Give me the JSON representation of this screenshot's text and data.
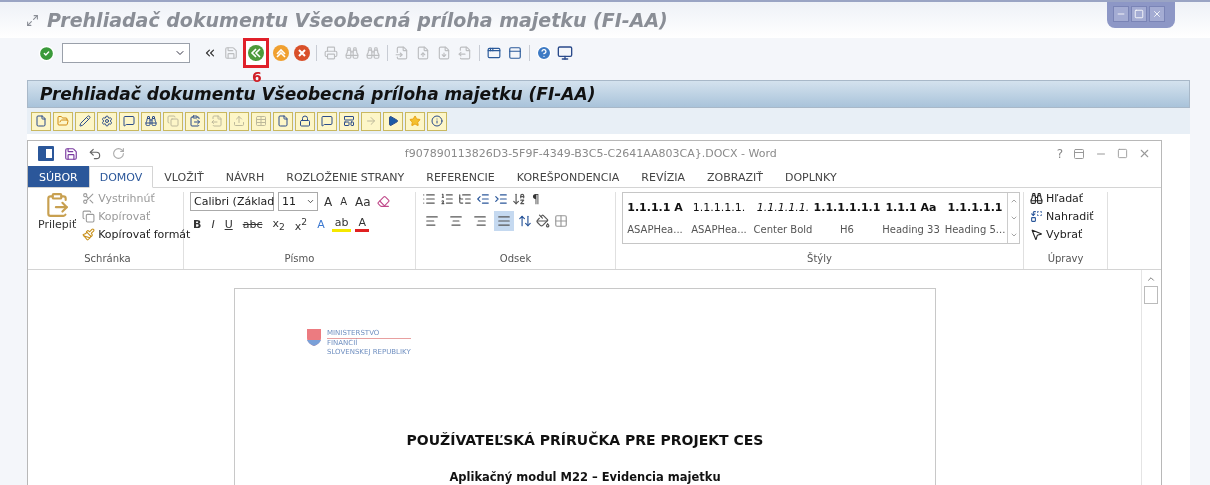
{
  "window": {
    "title": "Prehliadač dokumentu Všeobecná príloha majetku  (FI-AA)",
    "controls": [
      {
        "kind": "minimize"
      },
      {
        "kind": "maximize"
      },
      {
        "kind": "close"
      }
    ]
  },
  "toolbar": {
    "groups": [
      {
        "separator_before": false,
        "buttons": [
          {
            "kind": "enter",
            "disabled": false,
            "highlighted": false
          }
        ]
      },
      {
        "separator_before": false,
        "buttons": [
          {
            "kind": "collapse",
            "disabled": false,
            "highlighted": false
          },
          {
            "kind": "save",
            "disabled": true,
            "highlighted": false
          },
          {
            "kind": "back",
            "disabled": false,
            "highlighted": true
          },
          {
            "kind": "exit",
            "disabled": false,
            "highlighted": false
          },
          {
            "kind": "cancel",
            "disabled": false,
            "highlighted": false
          }
        ]
      },
      {
        "separator_before": true,
        "buttons": [
          {
            "kind": "print",
            "disabled": true,
            "highlighted": false
          },
          {
            "kind": "find",
            "disabled": true,
            "highlighted": false
          },
          {
            "kind": "findnext",
            "disabled": true,
            "highlighted": false
          }
        ]
      },
      {
        "separator_before": true,
        "buttons": [
          {
            "kind": "first",
            "disabled": true,
            "highlighted": false
          },
          {
            "kind": "previous",
            "disabled": true,
            "highlighted": false
          },
          {
            "kind": "next",
            "disabled": true,
            "highlighted": false
          },
          {
            "kind": "last",
            "disabled": true,
            "highlighted": false
          }
        ]
      },
      {
        "separator_before": true,
        "buttons": [
          {
            "kind": "session",
            "disabled": false,
            "highlighted": false
          },
          {
            "kind": "shortcut",
            "disabled": false,
            "highlighted": false
          }
        ]
      },
      {
        "separator_before": true,
        "buttons": [
          {
            "kind": "help",
            "disabled": false,
            "highlighted": false
          },
          {
            "kind": "layout",
            "disabled": false,
            "highlighted": false
          }
        ]
      }
    ],
    "annotation": "6"
  },
  "screen": {
    "title": "Prehliadač dokumentu Všeobecná príloha majetku  (FI-AA)",
    "app_toolbar": [
      {
        "kind": "new",
        "disabled": false
      },
      {
        "kind": "open",
        "disabled": false
      },
      {
        "kind": "edit",
        "disabled": false
      },
      {
        "kind": "settings",
        "disabled": false
      },
      {
        "kind": "comment",
        "disabled": false
      },
      {
        "kind": "find",
        "disabled": false
      },
      {
        "kind": "copy",
        "disabled": true
      },
      {
        "kind": "paste",
        "disabled": false
      },
      {
        "kind": "export",
        "disabled": true
      },
      {
        "kind": "upload",
        "disabled": true
      },
      {
        "kind": "table",
        "disabled": true
      },
      {
        "kind": "new",
        "disabled": false
      },
      {
        "kind": "lock",
        "disabled": false
      },
      {
        "kind": "comment",
        "disabled": false
      },
      {
        "kind": "template",
        "disabled": false
      },
      {
        "kind": "forward",
        "disabled": true
      },
      {
        "kind": "play",
        "disabled": false
      },
      {
        "kind": "star",
        "disabled": false
      },
      {
        "kind": "info",
        "disabled": false
      }
    ]
  },
  "word": {
    "title": "f907890113826D3-5F9F-4349-B3C5-C2641AA803CA}.DOCX - Word",
    "help": "?",
    "tabs": [
      {
        "label": "SÚBOR",
        "kind": "file",
        "selected": false
      },
      {
        "label": "DOMOV",
        "kind": "tab",
        "selected": true
      },
      {
        "label": "VLOŽIŤ",
        "kind": "tab",
        "selected": false
      },
      {
        "label": "NÁVRH",
        "kind": "tab",
        "selected": false
      },
      {
        "label": "ROZLOŽENIE STRANY",
        "kind": "tab",
        "selected": false
      },
      {
        "label": "REFERENCIE",
        "kind": "tab",
        "selected": false
      },
      {
        "label": "KOREŠPONDENCIA",
        "kind": "tab",
        "selected": false
      },
      {
        "label": "REVÍZIA",
        "kind": "tab",
        "selected": false
      },
      {
        "label": "ZOBRAZIŤ",
        "kind": "tab",
        "selected": false
      },
      {
        "label": "DOPLNKY",
        "kind": "tab",
        "selected": false
      }
    ],
    "clipboard": {
      "group": "Schránka",
      "paste": "Prilepiť",
      "items": [
        {
          "kind": "cut",
          "label": "Vystrihnúť",
          "disabled": true
        },
        {
          "kind": "copy",
          "label": "Kopírovať",
          "disabled": true
        },
        {
          "kind": "format",
          "label": "Kopírovať formát",
          "disabled": false
        }
      ]
    },
    "font": {
      "group": "Písmo",
      "name": "Calibri (Základ",
      "size": "11",
      "grow": "A",
      "shrink": "A",
      "case": "Aa",
      "format_buttons": [
        {
          "kind": "bold",
          "label": "B"
        },
        {
          "kind": "italic",
          "label": "I"
        },
        {
          "kind": "underline",
          "label": "U"
        },
        {
          "kind": "strike",
          "label": "abc"
        },
        {
          "kind": "sub",
          "label": "x$_{2}$"
        },
        {
          "kind": "sup",
          "label": "x$^{2}$"
        },
        {
          "kind": "effect",
          "label": "A"
        },
        {
          "kind": "highlight",
          "label": "ab"
        },
        {
          "kind": "color",
          "label": "A"
        }
      ]
    },
    "paragraph": {
      "group": "Odsek",
      "pilcrow": "¶",
      "alignments": [
        {
          "kind": "left",
          "selected": false
        },
        {
          "kind": "center",
          "selected": false
        },
        {
          "kind": "right",
          "selected": false
        },
        {
          "kind": "justify",
          "selected": true
        }
      ]
    },
    "styles": {
      "group": "Štýly",
      "items": [
        {
          "preview": "1.1.1.1  A",
          "name": "ASAPHea...",
          "kind": "bold"
        },
        {
          "preview": "1.1.1.1.1.",
          "name": "ASAPHea...",
          "kind": "normal"
        },
        {
          "preview": "1.1.1.1.1.",
          "name": "Center Bold",
          "kind": "italic"
        },
        {
          "preview": "1.1.1.1.1.1",
          "name": "H6",
          "kind": "bold"
        },
        {
          "preview": "1.1.1  Aa",
          "name": "Heading 33",
          "kind": "bold"
        },
        {
          "preview": "1.1.1.1.1",
          "name": "Heading 5...",
          "kind": "bold"
        }
      ]
    },
    "editing": {
      "group": "Úpravy",
      "items": [
        {
          "kind": "find",
          "label": "Hľadať"
        },
        {
          "kind": "replace",
          "label": "Nahradiť"
        },
        {
          "kind": "select",
          "label": "Vybrať"
        }
      ]
    }
  },
  "document": {
    "logo_lines": [
      "MINISTERSTVO",
      "FINANCIÍ",
      "SLOVENSKEJ REPUBLIKY"
    ],
    "title": "POUŽÍVATEĽSKÁ PRÍRUČKA PRE PROJEKT CES",
    "subtitle": "Aplikačný modul M22 – Evidencia majetku"
  }
}
